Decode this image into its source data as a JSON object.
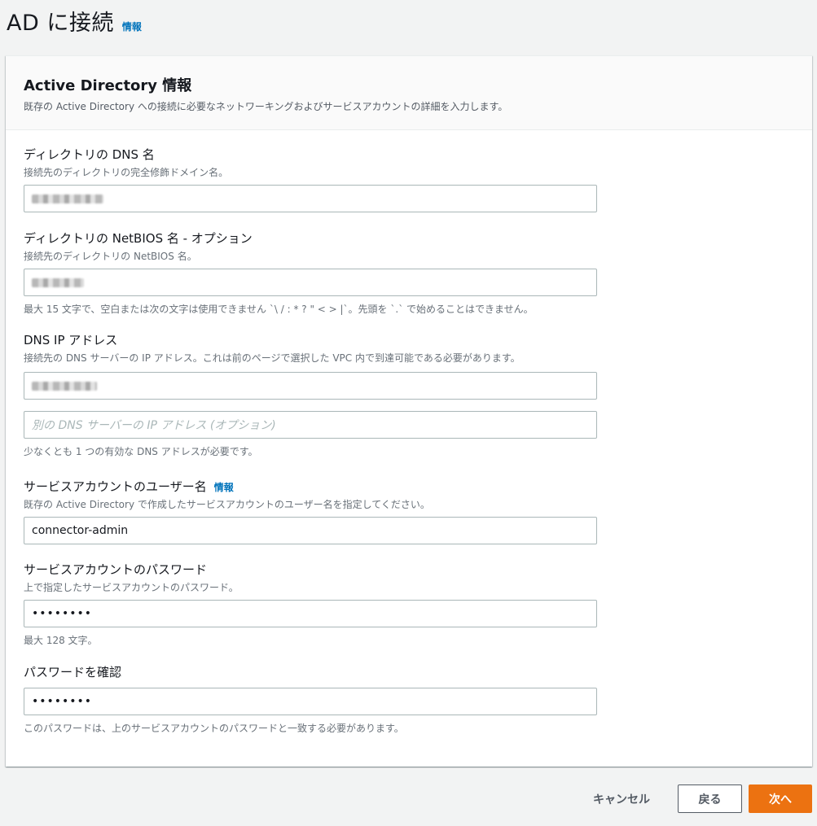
{
  "page": {
    "title": "AD に接続",
    "info_link": "情報"
  },
  "section": {
    "title": "Active Directory 情報",
    "description": "既存の Active Directory への接続に必要なネットワーキングおよびサービスアカウントの詳細を入力します。"
  },
  "fields": {
    "dns_name": {
      "label": "ディレクトリの DNS 名",
      "description": "接続先のディレクトリの完全修飾ドメイン名。"
    },
    "netbios_name": {
      "label": "ディレクトリの NetBIOS 名 - オプション",
      "description": "接続先のディレクトリの NetBIOS 名。",
      "constraint": "最大 15 文字で、空白または次の文字は使用できません `\\ / : * ? \" < > |`。先頭を `.` で始めることはできません。"
    },
    "dns_ip": {
      "label": "DNS IP アドレス",
      "description": "接続先の DNS サーバーの IP アドレス。これは前のページで選択した VPC 内で到達可能である必要があります。",
      "secondary_placeholder": "別の DNS サーバーの IP アドレス (オプション)",
      "constraint": "少なくとも 1 つの有効な DNS アドレスが必要です。"
    },
    "service_username": {
      "label": "サービスアカウントのユーザー名",
      "info_link": "情報",
      "description": "既存の Active Directory で作成したサービスアカウントのユーザー名を指定してください。",
      "value": "connector-admin"
    },
    "service_password": {
      "label": "サービスアカウントのパスワード",
      "description": "上で指定したサービスアカウントのパスワード。",
      "value": "••••••••",
      "constraint": "最大 128 文字。"
    },
    "confirm_password": {
      "label": "パスワードを確認",
      "value": "••••••••",
      "constraint": "このパスワードは、上のサービスアカウントのパスワードと一致する必要があります。"
    }
  },
  "buttons": {
    "cancel": "キャンセル",
    "back": "戻る",
    "next": "次へ"
  },
  "colors": {
    "primary": "#ec7211",
    "link": "#0073bb",
    "background": "#f2f3f3"
  }
}
